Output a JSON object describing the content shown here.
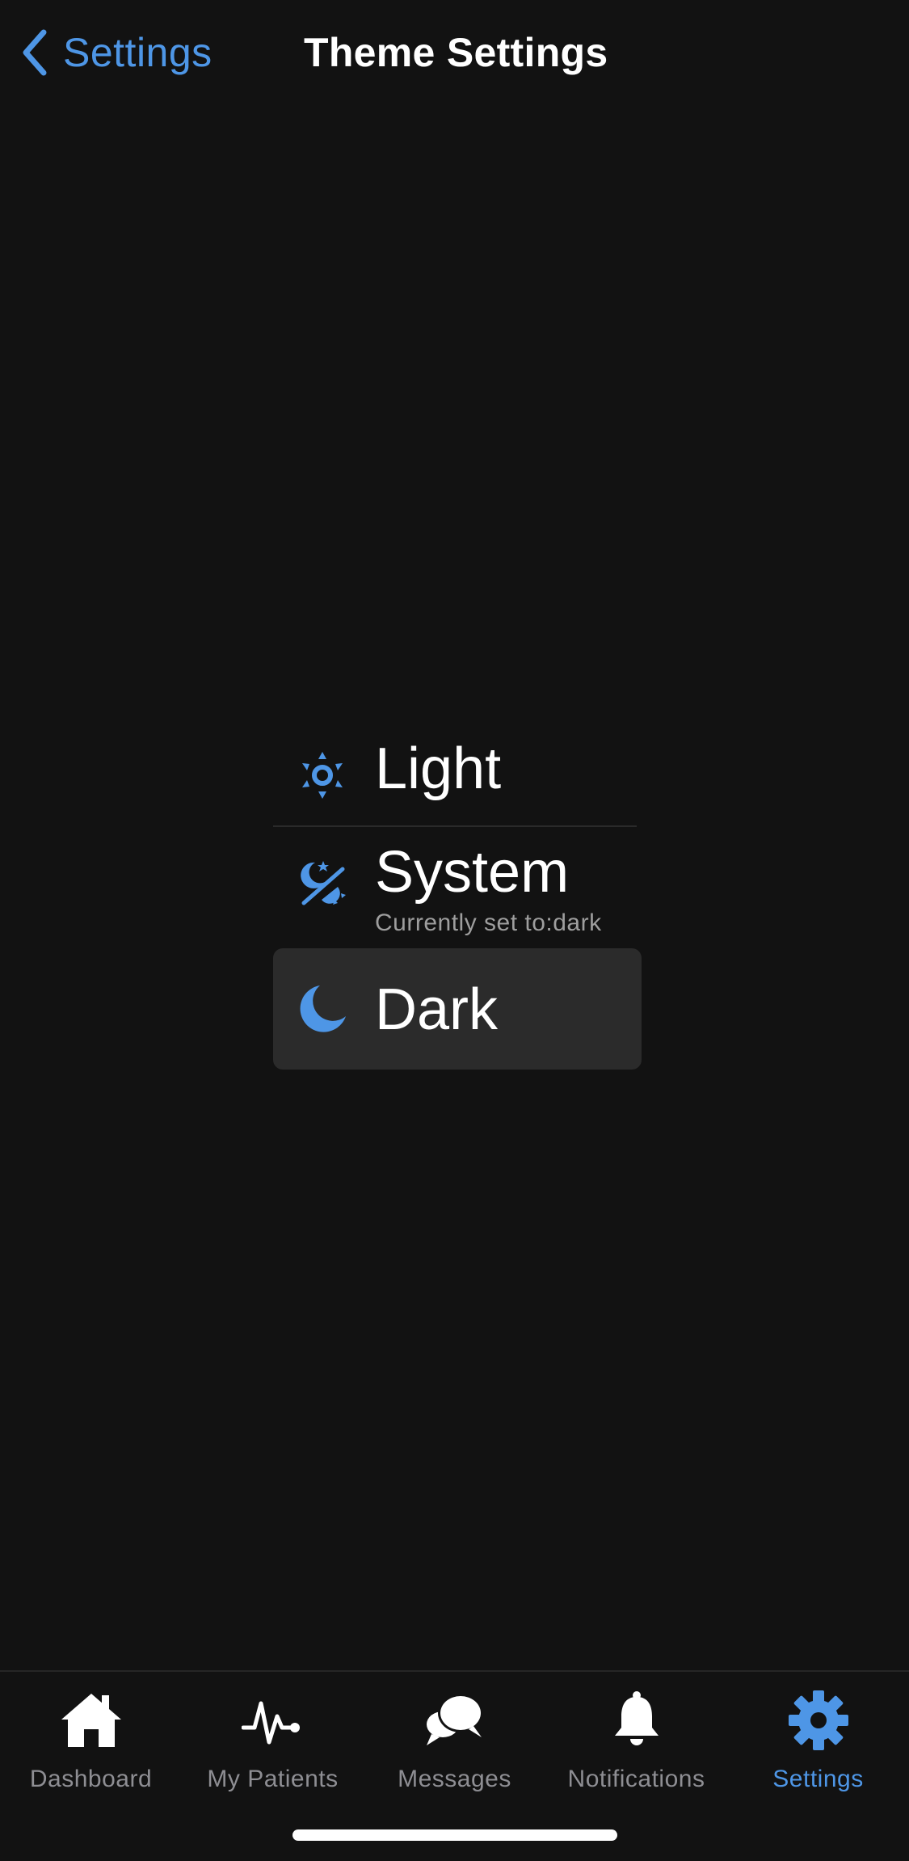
{
  "header": {
    "back_label": "Settings",
    "title": "Theme Settings"
  },
  "themes": {
    "light": {
      "label": "Light",
      "icon": "sun-icon"
    },
    "system": {
      "label": "System",
      "subtitle": "Currently set to:dark",
      "icon": "auto-theme-icon"
    },
    "dark": {
      "label": "Dark",
      "icon": "moon-icon",
      "selected": true
    }
  },
  "tabs": [
    {
      "label": "Dashboard",
      "icon": "home-icon"
    },
    {
      "label": "My Patients",
      "icon": "heartbeat-icon"
    },
    {
      "label": "Messages",
      "icon": "chat-bubbles-icon"
    },
    {
      "label": "Notifications",
      "icon": "bell-icon"
    },
    {
      "label": "Settings",
      "icon": "gear-icon",
      "active": true
    }
  ],
  "colors": {
    "background": "#121212",
    "accent": "#4e96e6",
    "selected_row": "#2b2b2b",
    "inactive_tab": "#8e8e93"
  }
}
